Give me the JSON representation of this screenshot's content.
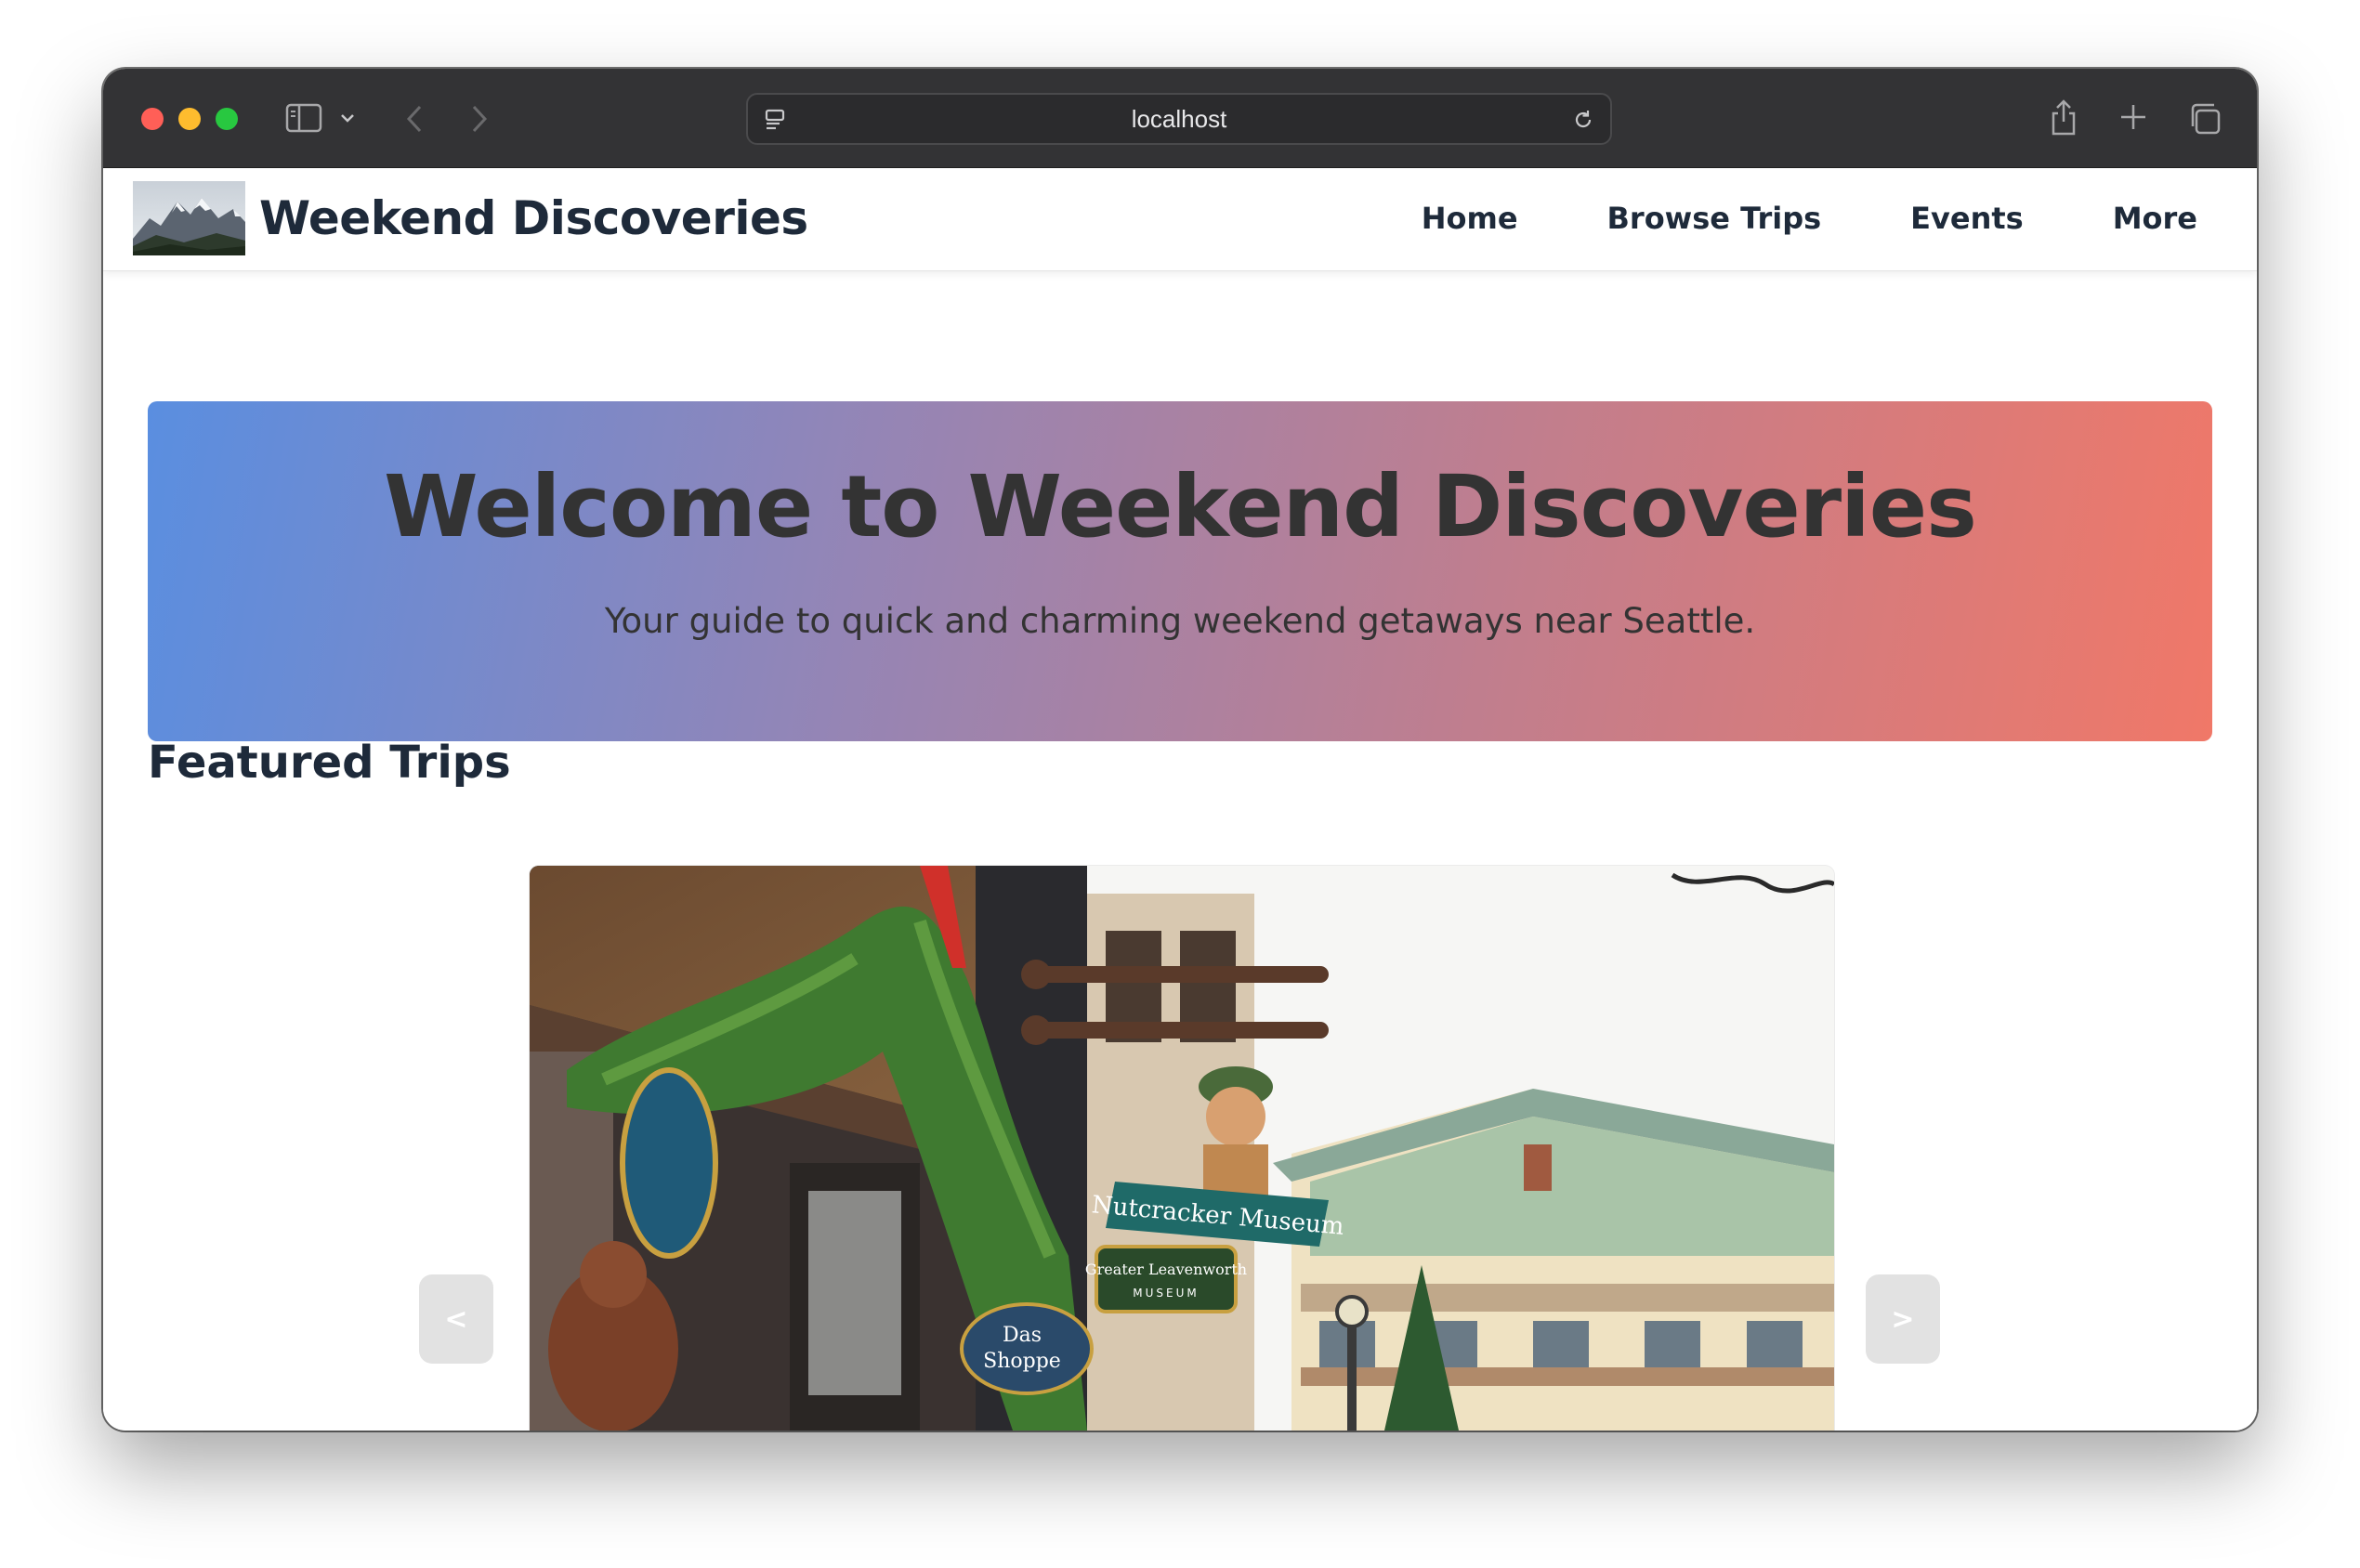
{
  "browser": {
    "url": "localhost"
  },
  "site": {
    "brand": "Weekend Discoveries",
    "logo_alt": "mountain-logo",
    "nav": [
      "Home",
      "Browse Trips",
      "Events",
      "More"
    ]
  },
  "hero": {
    "title": "Welcome to Weekend Discoveries",
    "subtitle": "Your guide to quick and charming weekend getaways near Seattle."
  },
  "featured": {
    "title": "Featured Trips",
    "prev_label": "<",
    "next_label": ">",
    "signs": {
      "nutcracker": "Nutcracker Museum",
      "greater": "Greater Leavenworth",
      "museum": "MUSEUM",
      "das": "Das",
      "shoppe": "Shoppe"
    }
  },
  "colors": {
    "hero_gradient_start": "#5a8ee0",
    "hero_gradient_end": "#f07868",
    "text_dark": "#1e2a3a"
  }
}
